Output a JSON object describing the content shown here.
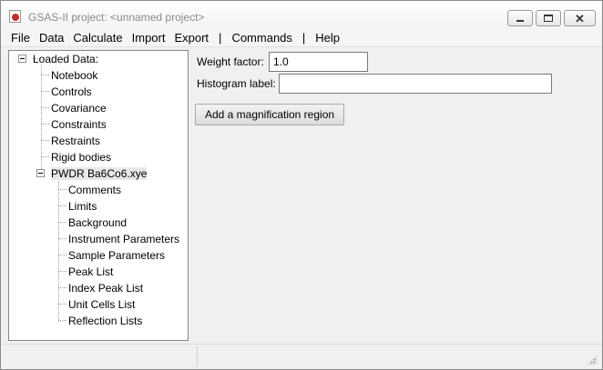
{
  "window": {
    "title": "GSAS-II project: <unnamed project>",
    "min_glyph": "",
    "close_glyph": "✕"
  },
  "menu": [
    "File",
    "Data",
    "Calculate",
    "Import",
    "Export",
    "|",
    "Commands",
    "|",
    "Help"
  ],
  "tree": {
    "root": "Loaded Data:",
    "top_items": [
      "Notebook",
      "Controls",
      "Covariance",
      "Constraints",
      "Restraints",
      "Rigid bodies"
    ],
    "histogram": "PWDR Ba6Co6.xye",
    "hist_items": [
      "Comments",
      "Limits",
      "Background",
      "Instrument Parameters",
      "Sample Parameters",
      "Peak List",
      "Index Peak List",
      "Unit Cells List",
      "Reflection Lists"
    ]
  },
  "form": {
    "weight_label": "Weight factor:",
    "weight_value": "1.0",
    "hist_label": "Histogram label:",
    "hist_value": "",
    "mag_button": "Add a magnification region"
  }
}
